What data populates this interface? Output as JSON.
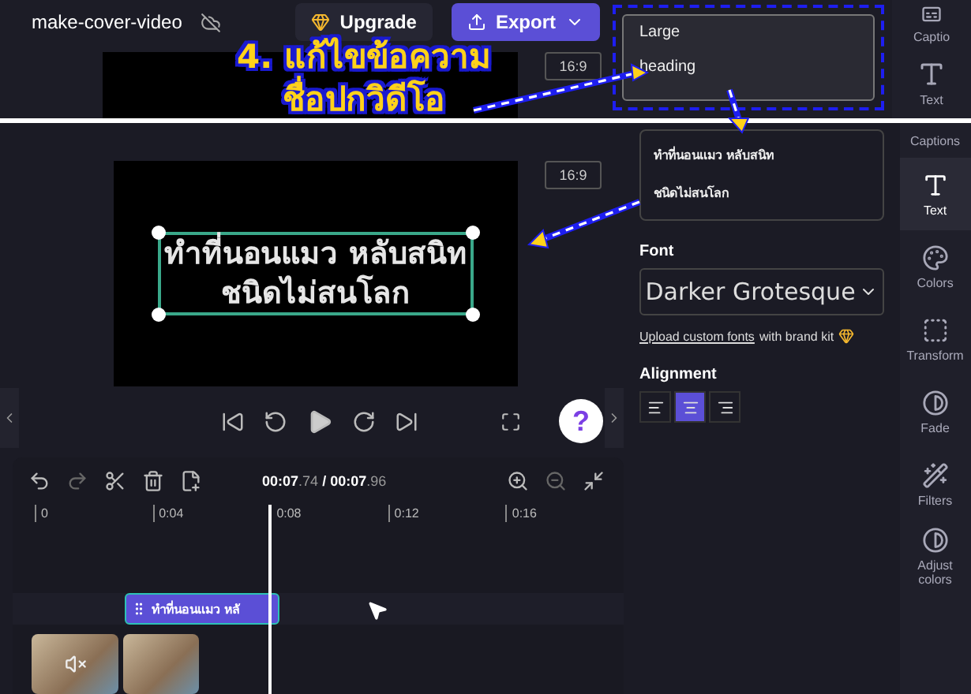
{
  "inset": {
    "project_title": "make-cover-video",
    "upgrade_button": "Upgrade",
    "export_button": "Export",
    "aspect_ratio": "16:9",
    "text_value": "Large\nheading",
    "rail": [
      {
        "label": "Captio"
      },
      {
        "label": "Text"
      }
    ]
  },
  "callout": {
    "lines": [
      "4. แก้ไขข้อความ",
      "ชื่อปกวิดีโอ"
    ]
  },
  "preview": {
    "aspect_ratio": "16:9",
    "canvas_text": "ทำที่นอนแมว หลับสนิท\nชนิดไม่สนโลก",
    "help_label": "?"
  },
  "timeline": {
    "time_current": "00:07",
    "time_current_frac": ".74",
    "separator": "/",
    "time_total": "00:07",
    "time_total_frac": ".96",
    "ruler": [
      "0",
      "0:04",
      "0:08",
      "0:12",
      "0:16"
    ],
    "text_clip": "ทำที่นอนแมว หลั"
  },
  "panel": {
    "text_value": "ทำที่นอนแมว หลับสนิท\nชนิดไม่สนโลก",
    "font_label": "Font",
    "font_value": "Darker Grotesque",
    "upload_link": "Upload custom fonts",
    "upload_suffix": "with brand kit",
    "alignment_label": "Alignment",
    "alignments": [
      {
        "kind": "left",
        "selected": false
      },
      {
        "kind": "center",
        "selected": true
      },
      {
        "kind": "right",
        "selected": false
      }
    ]
  },
  "rail": [
    {
      "label": "Captions",
      "selected": false
    },
    {
      "label": "Text",
      "selected": true
    },
    {
      "label": "Colors",
      "selected": false
    },
    {
      "label": "Transform",
      "selected": false
    },
    {
      "label": "Fade",
      "selected": false
    },
    {
      "label": "Filters",
      "selected": false
    },
    {
      "label": "Adjust colors",
      "selected": false
    }
  ]
}
